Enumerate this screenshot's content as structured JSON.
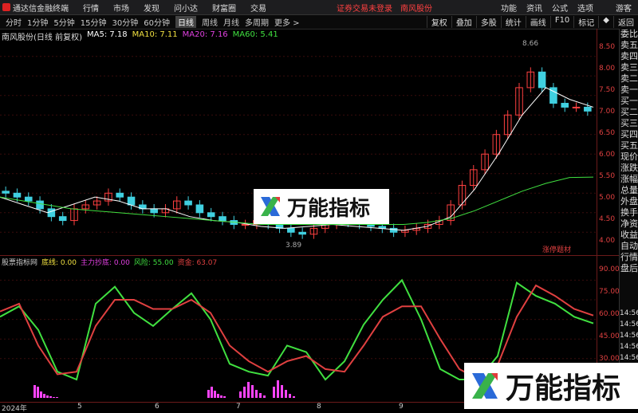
{
  "menubar": {
    "app_title": "通达信金融终端",
    "items": [
      "行情",
      "市场",
      "发现",
      "问小达",
      "财富圈",
      "交易"
    ],
    "notice": "证券交易未登录",
    "stock_name": "南风股份",
    "right_items": [
      "功能",
      "资讯",
      "公式",
      "选项"
    ],
    "guest": "游客"
  },
  "toolbar": {
    "periods": [
      "分时",
      "1分钟",
      "5分钟",
      "15分钟",
      "30分钟",
      "60分钟",
      "日线",
      "周线",
      "月线",
      "多周期",
      "更多 >"
    ],
    "active_period": "日线",
    "buttons": [
      "复权",
      "叠加",
      "多股",
      "统计",
      "画线",
      "F10",
      "标记",
      "◆",
      "返回"
    ]
  },
  "main_chart": {
    "stock_label": "南风股份(日线 前复权)",
    "ma_legend": [
      {
        "label": "MA5: 7.18",
        "color": "#ffffff"
      },
      {
        "label": "MA10: 7.11",
        "color": "#f0e040"
      },
      {
        "label": "MA20: 7.16",
        "color": "#e040e0"
      },
      {
        "label": "MA60: 5.41",
        "color": "#40e040"
      }
    ],
    "high_label": "8.66",
    "low_label": "3.89",
    "tag_label": "涨停题材"
  },
  "price_axis": [
    "8.50",
    "8.00",
    "7.50",
    "7.00",
    "6.50",
    "6.00",
    "5.50",
    "5.00",
    "4.50",
    "4.00"
  ],
  "sub_chart": {
    "legend": [
      {
        "label": "股票指标网",
        "color": "#cccccc"
      },
      {
        "label": "底线: 0.00",
        "color": "#f0e040"
      },
      {
        "label": "主力抄底: 0.00",
        "color": "#e040e0"
      },
      {
        "label": "风险: 55.00",
        "color": "#40e040"
      },
      {
        "label": "资金: 63.07",
        "color": "#e04040"
      }
    ],
    "axis": [
      "90.00",
      "75.00",
      "60.00",
      "45.00",
      "30.00"
    ]
  },
  "side_column": {
    "items": [
      "委比",
      "卖五",
      "卖四",
      "卖三",
      "卖二",
      "卖一",
      "买一",
      "买二",
      "买三",
      "买四",
      "买五",
      "现价",
      "涨跌",
      "涨幅",
      "总量",
      "外盘",
      "换手",
      "净资",
      "收益",
      "自动",
      "行情",
      "盘后"
    ],
    "times": [
      "14:56",
      "14:56",
      "14:56",
      "14:56",
      "14:56",
      "14:55",
      "14:55",
      "14:55"
    ]
  },
  "time_axis": {
    "labels": [
      "2024年",
      "5",
      "6",
      "7",
      "8",
      "9"
    ]
  },
  "watermark": {
    "text": "万能指标"
  },
  "chart_data": {
    "type": "candlestick",
    "title": "南风股份(日线 前复权)",
    "ylim": [
      3.7,
      8.8
    ],
    "candles_approx_close": [
      5.0,
      4.9,
      4.8,
      4.6,
      4.4,
      4.3,
      4.6,
      4.7,
      4.8,
      5.0,
      4.9,
      4.7,
      4.6,
      4.5,
      4.6,
      4.8,
      4.7,
      4.5,
      4.4,
      4.3,
      4.2,
      4.2,
      4.3,
      4.2,
      4.1,
      4.0,
      3.95,
      4.1,
      4.2,
      4.3,
      4.25,
      4.2,
      4.15,
      4.1,
      4.0,
      4.05,
      4.1,
      4.2,
      4.3,
      4.7,
      5.2,
      5.6,
      6.0,
      6.5,
      7.0,
      7.7,
      8.1,
      7.7,
      7.3,
      7.2,
      7.2,
      7.1
    ],
    "ma_series": [
      {
        "name": "MA5",
        "values": [
          4.9,
          4.7,
          4.5,
          4.7,
          4.9,
          4.8,
          4.6,
          4.6,
          4.4,
          4.3,
          4.25,
          4.15,
          4.1,
          4.15,
          4.2,
          4.15,
          4.1,
          4.05,
          4.15,
          4.4,
          5.1,
          6.0,
          7.0,
          7.7,
          7.4,
          7.2
        ]
      },
      {
        "name": "MA60",
        "values": [
          4.9,
          4.8,
          4.7,
          4.6,
          4.55,
          4.5,
          4.45,
          4.4,
          4.35,
          4.3,
          4.25,
          4.2,
          4.2,
          4.2,
          4.2,
          4.2,
          4.2,
          4.2,
          4.25,
          4.35,
          4.55,
          4.8,
          5.05,
          5.25,
          5.4,
          5.41
        ]
      }
    ],
    "sub_series": [
      {
        "name": "风险",
        "values": [
          62,
          70,
          52,
          20,
          14,
          72,
          85,
          65,
          55,
          68,
          80,
          60,
          26,
          20,
          17,
          40,
          35,
          14,
          28,
          56,
          75,
          90,
          60,
          22,
          14,
          14,
          32,
          88,
          78,
          72,
          62,
          57
        ]
      },
      {
        "name": "资金",
        "values": [
          66,
          72,
          40,
          18,
          20,
          55,
          75,
          75,
          68,
          68,
          75,
          65,
          40,
          28,
          20,
          28,
          32,
          22,
          20,
          40,
          62,
          70,
          70,
          45,
          22,
          14,
          25,
          62,
          86,
          78,
          68,
          63
        ]
      }
    ]
  }
}
